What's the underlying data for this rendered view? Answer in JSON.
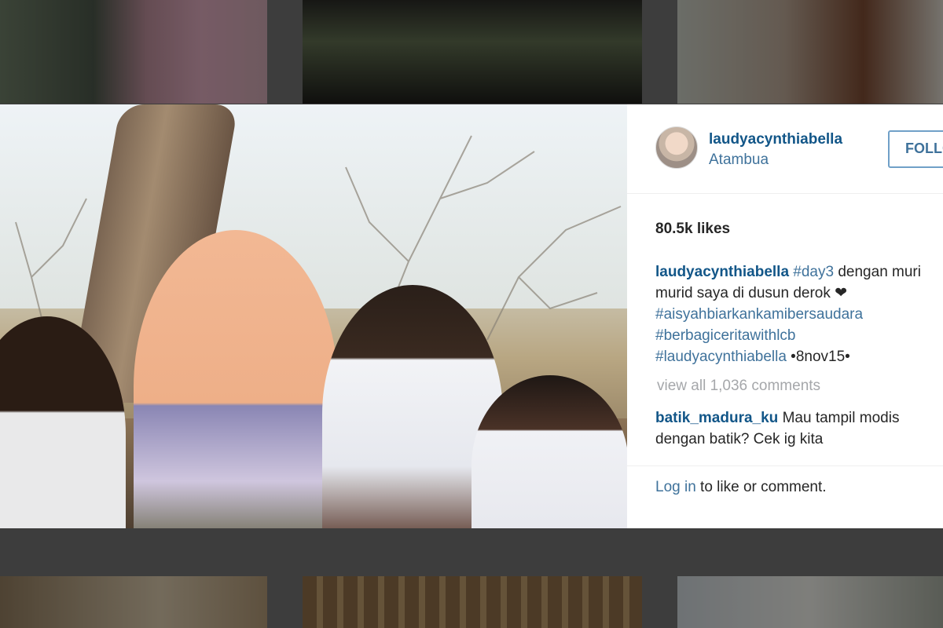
{
  "post": {
    "username": "laudyacynthiabella",
    "location": "Atambua",
    "follow_label": "FOLLOW",
    "likes": "80.5k likes",
    "caption": {
      "author": "laudyacynthiabella",
      "line1_tag": "#day3",
      "line1_text": " dengan muri",
      "line2_text": "murid saya di dusun derok",
      "heart_icon": "❤",
      "tag2": "#aisyahbiarkankamibersaudara",
      "tag3": "#berbagiceritawithlcb",
      "tag4": "#laudyacynthiabella",
      "date_text": " •8nov15•"
    },
    "view_all": "view all 1,036 comments",
    "comment": {
      "author": "batik_madura_ku",
      "text_line1": " Mau tampil modis",
      "text_line2": "dengan batik? Cek ig kita"
    },
    "login_link": "Log in",
    "login_text": " to like or comment."
  }
}
